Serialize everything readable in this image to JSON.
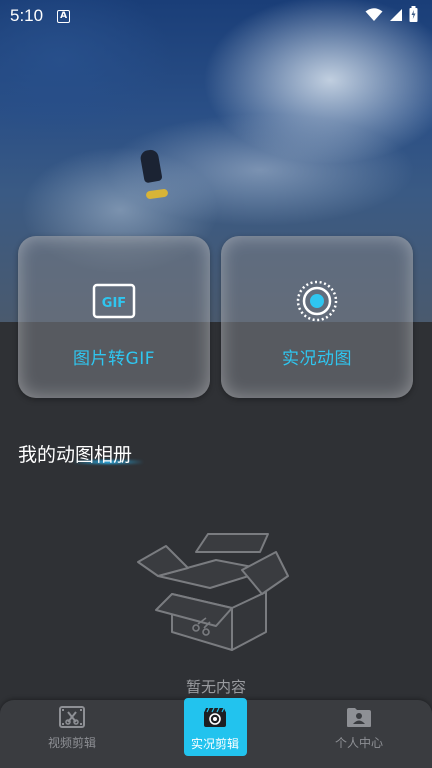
{
  "status_bar": {
    "time": "5:10",
    "notification_glyph": "A",
    "icons": [
      "wifi-icon",
      "signal-icon",
      "battery-icon"
    ]
  },
  "cards": [
    {
      "label": "图片转GIF",
      "icon": "gif-icon"
    },
    {
      "label": "实况动图",
      "icon": "live-photo-icon"
    }
  ],
  "album": {
    "title": "我的动图相册"
  },
  "empty_state": {
    "text": "暂无内容",
    "icon": "empty-box-icon"
  },
  "bottom_nav": {
    "items": [
      {
        "label": "视频剪辑",
        "icon": "video-edit-icon",
        "active": false
      },
      {
        "label": "实况剪辑",
        "icon": "camera-icon",
        "active": true
      },
      {
        "label": "个人中心",
        "icon": "profile-icon",
        "active": false
      }
    ]
  },
  "colors": {
    "accent": "#22c3ee",
    "background": "#2f3135",
    "nav_background": "#3a3c40",
    "muted_text": "#8e9095"
  }
}
